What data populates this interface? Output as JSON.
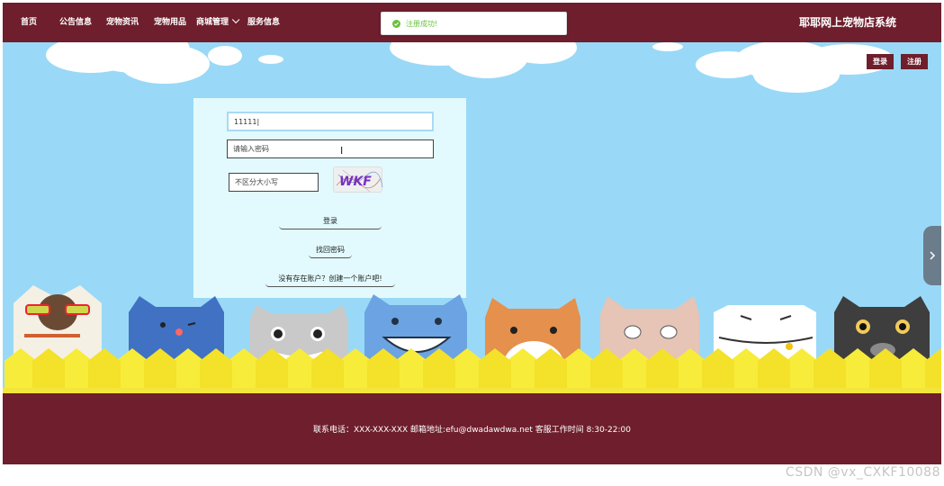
{
  "nav": {
    "items": [
      "首页",
      "公告信息",
      "宠物资讯",
      "宠物用品",
      "商城管理",
      "服务信息"
    ],
    "site_title": "耶耶网上宠物店系统"
  },
  "toast": {
    "message": "注册成功!",
    "icon": "check-circle-icon",
    "color": "#67c23a"
  },
  "auth": {
    "login_label": "登录",
    "register_label": "注册"
  },
  "login_form": {
    "username_value": "11111|",
    "password_placeholder": "请输入密码",
    "captcha_placeholder": "不区分大小写",
    "captcha_text": "WKF",
    "login_button": "登录",
    "forgot_link": "找回密码",
    "create_account_link": "没有存在账户？创建一个账户吧!"
  },
  "footer": {
    "text": "联系电话：XXX-XXX-XXX 邮箱地址:efu@dwadawdwa.net 客服工作时间 8:30-22:00"
  },
  "watermark": "CSDN @vx_CXKF10088",
  "colors": {
    "brand": "#6e1e2c",
    "sky": "#99d9f7",
    "fence": "#f4e53c"
  }
}
